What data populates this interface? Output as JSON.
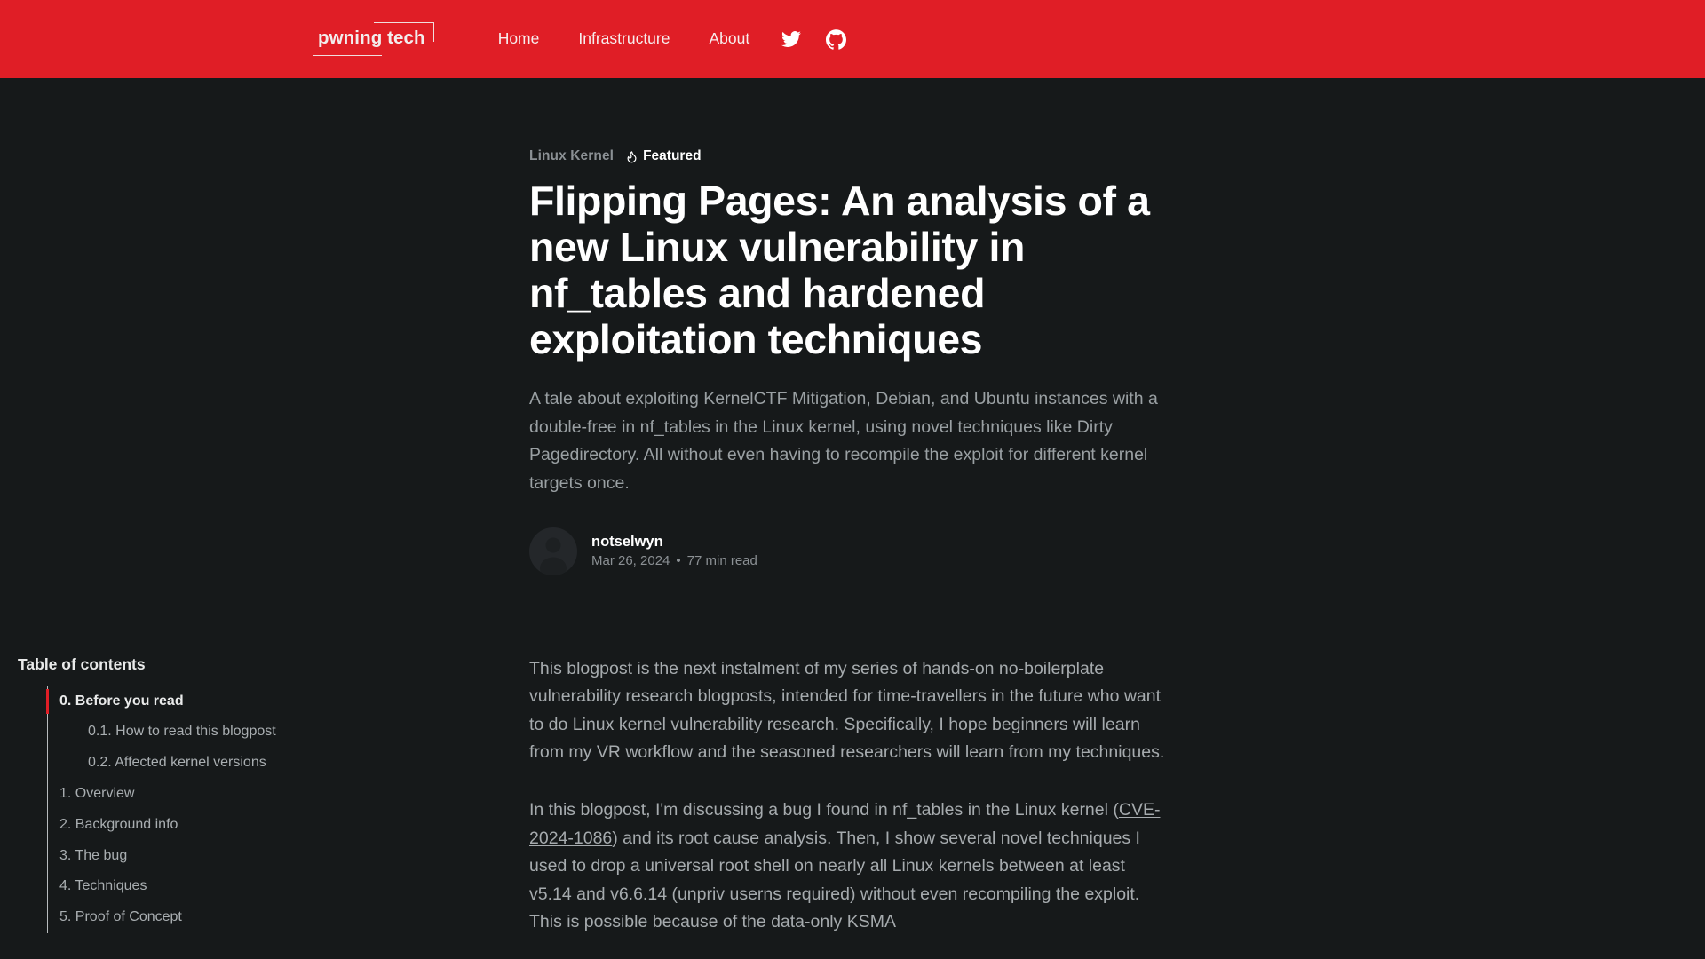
{
  "theme": {
    "header_bg": "#e01e26",
    "page_bg": "#16191a",
    "accent": "#e01e26",
    "text_primary": "#ffffff",
    "text_muted": "#9aa0a3"
  },
  "header": {
    "logo_text": "pwning tech",
    "nav": [
      {
        "label": "Home",
        "name": "nav-link-home"
      },
      {
        "label": "Infrastructure",
        "name": "nav-link-infrastructure"
      },
      {
        "label": "About",
        "name": "nav-link-about"
      }
    ],
    "icons": [
      {
        "label": "twitter-icon"
      },
      {
        "label": "github-icon"
      }
    ]
  },
  "article": {
    "category": "Linux Kernel",
    "featured_label": "Featured",
    "featured_icon": "flame-icon",
    "title": "Flipping Pages: An analysis of a new Linux vulnerability in nf_tables and hardened exploitation techniques",
    "excerpt": "A tale about exploiting KernelCTF Mitigation, Debian, and Ubuntu instances with a double-free in nf_tables in the Linux kernel, using novel techniques like Dirty Pagedirectory. All without even having to recompile the exploit for different kernel targets once.",
    "author": "notselwyn",
    "date": "Mar 26, 2024",
    "separator": "•",
    "read_time": "77 min read"
  },
  "toc": {
    "title": "Table of contents",
    "items": [
      {
        "label": "0. Before you read",
        "level": 0,
        "active": true
      },
      {
        "label": "0.1. How to read this blogpost",
        "level": 1,
        "active": false
      },
      {
        "label": "0.2. Affected kernel versions",
        "level": 1,
        "active": false
      },
      {
        "label": "1. Overview",
        "level": 0,
        "active": false
      },
      {
        "label": "2. Background info",
        "level": 0,
        "active": false
      },
      {
        "label": "3. The bug",
        "level": 0,
        "active": false
      },
      {
        "label": "4. Techniques",
        "level": 0,
        "active": false
      },
      {
        "label": "5. Proof of Concept",
        "level": 0,
        "active": false
      }
    ]
  },
  "body": {
    "paragraph_1": "This blogpost is the next instalment of my series of hands-on no-boilerplate vulnerability research blogposts, intended for time-travellers in the future who want to do Linux kernel vulnerability research. Specifically, I hope beginners will learn from my VR workflow and the seasoned researchers will learn from my techniques.",
    "paragraph_2_part1": "In this blogpost, I'm discussing a bug I found in nf_tables in the Linux kernel (",
    "paragraph_2_link": "CVE-2024-1086",
    "paragraph_2_part2": ") and its root cause analysis. Then, I show several novel techniques I used to drop a universal root shell on nearly all Linux kernels between at least v5.14 and v6.6.14 (unpriv userns required) without even recompiling the exploit. This is possible because of the data-only KSMA"
  }
}
